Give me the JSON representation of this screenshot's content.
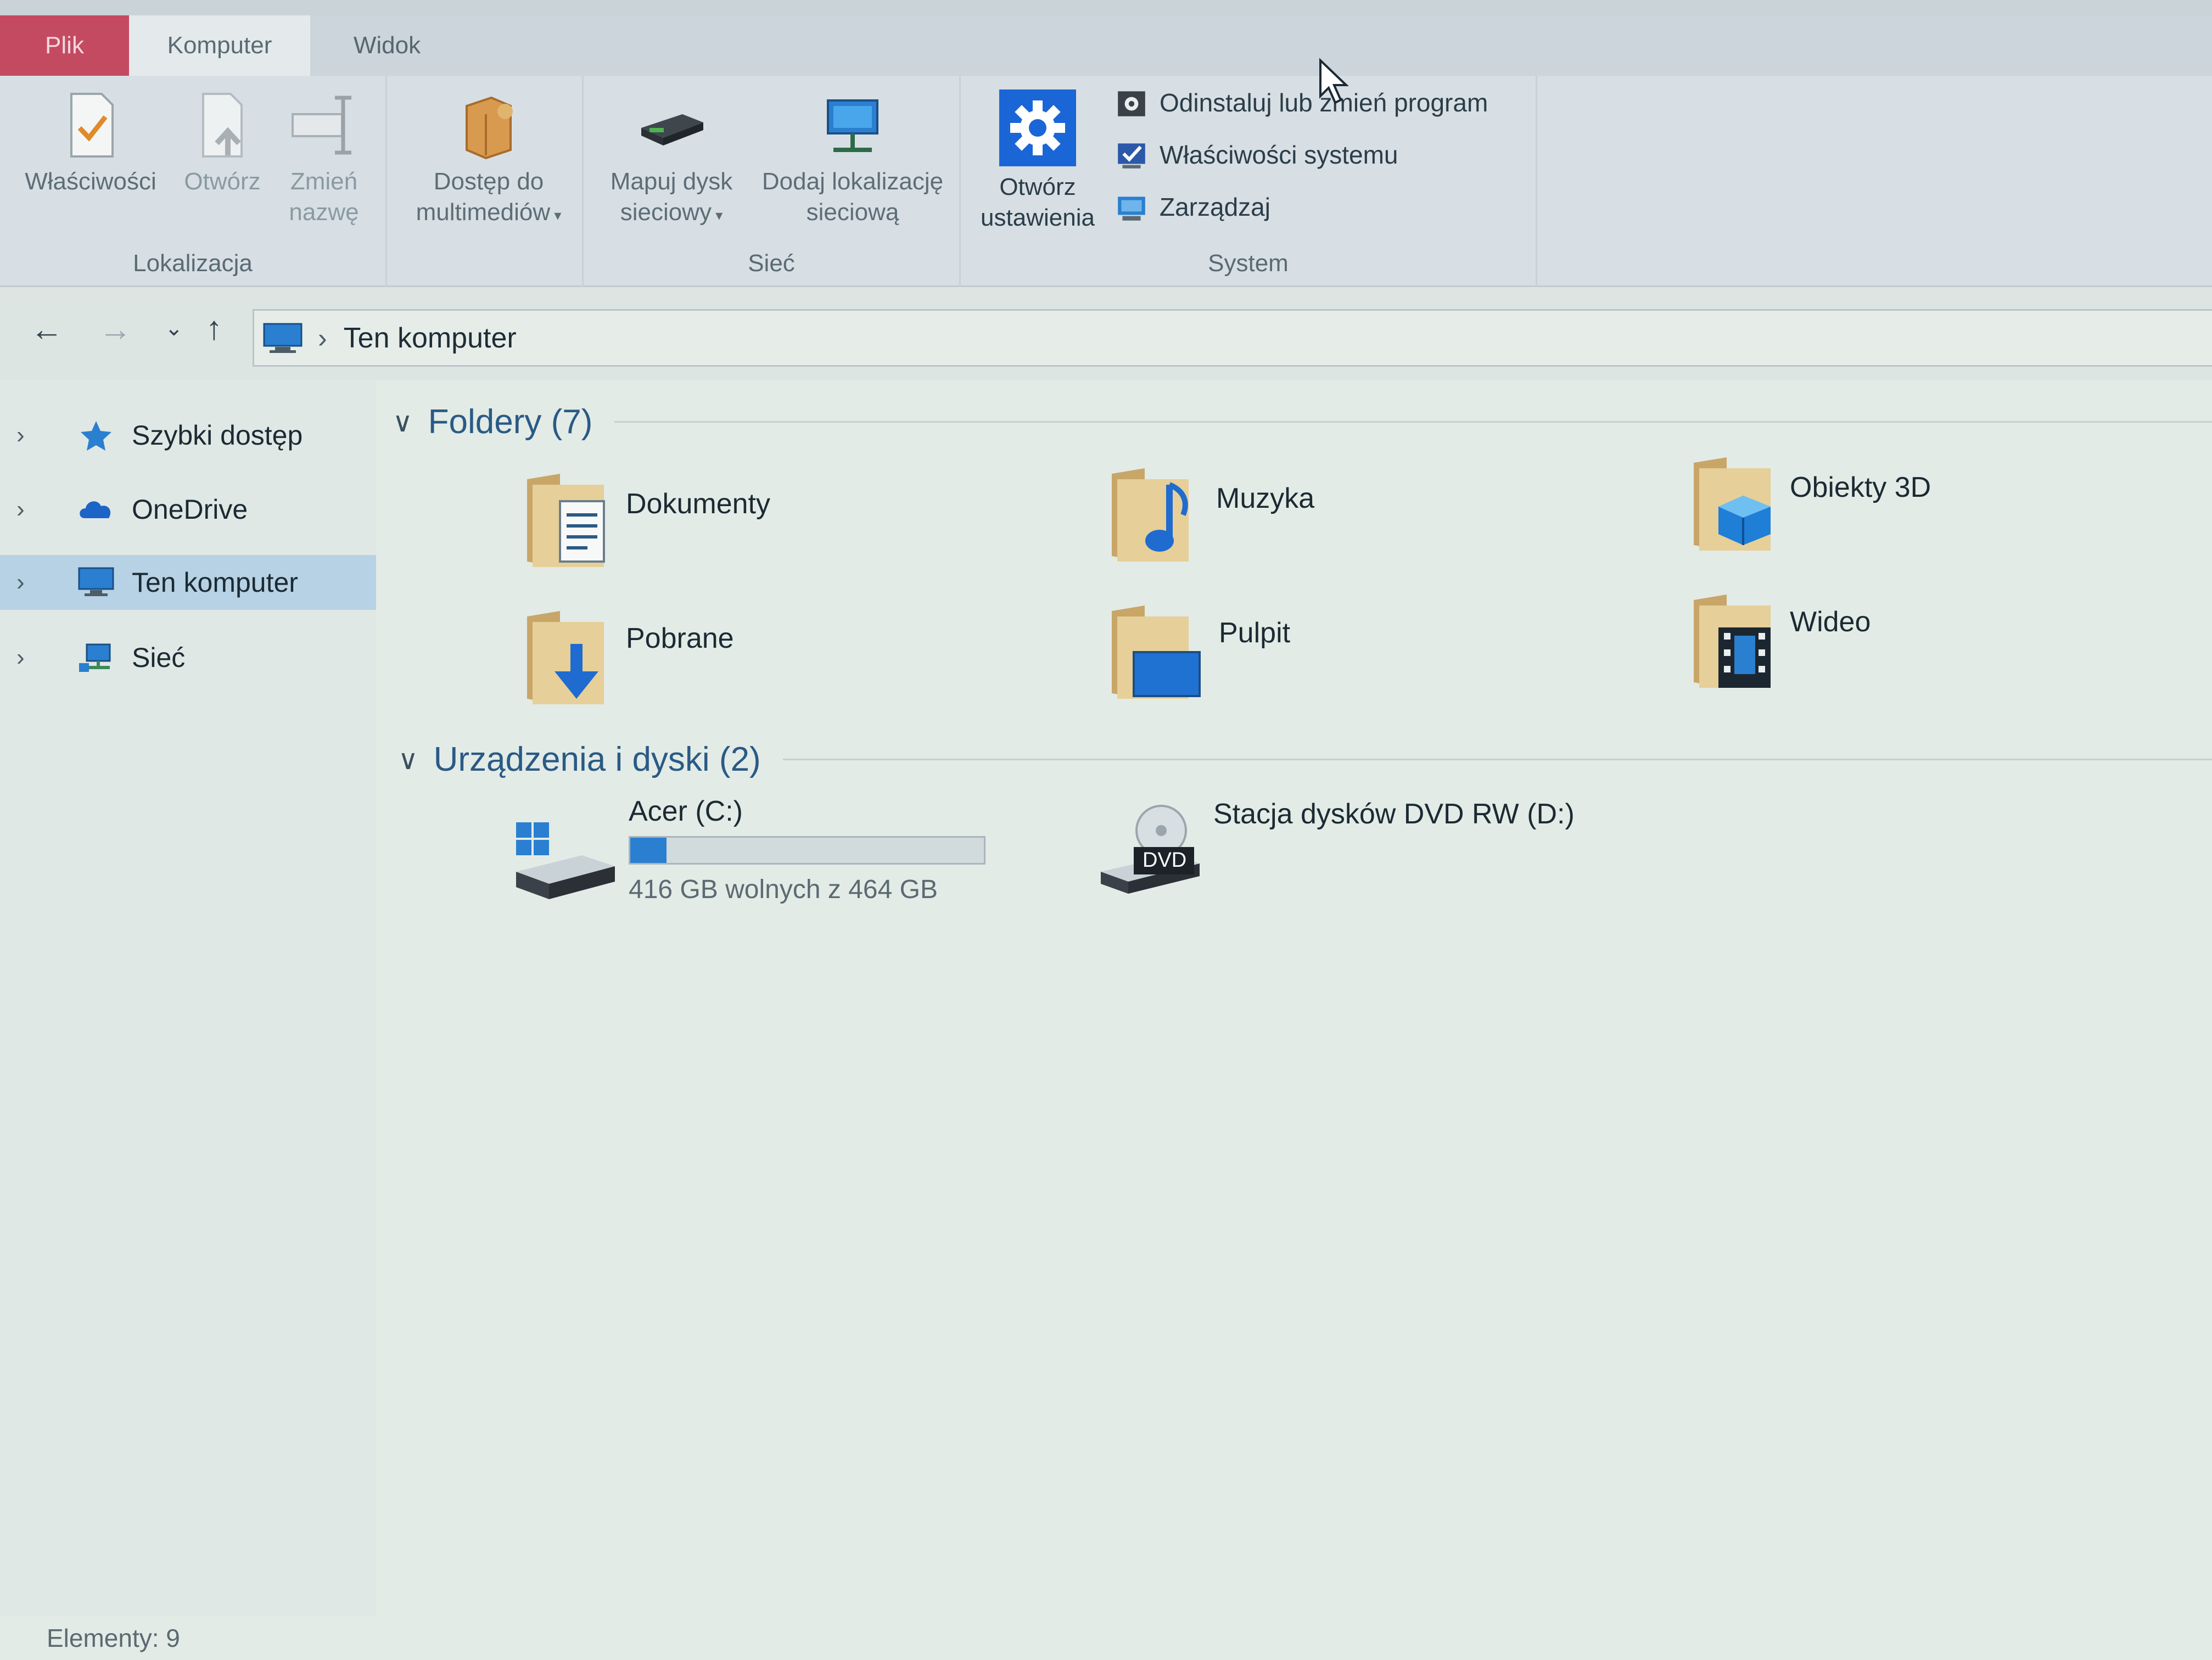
{
  "ribbon_tabs": [
    {
      "label": "Plik"
    },
    {
      "label": "Komputer"
    },
    {
      "label": "Widok"
    }
  ],
  "ribbon": {
    "location_group": {
      "label": "Lokalizacja",
      "properties": "Właściwości",
      "open": "Otwórz",
      "rename_line1": "Zmień",
      "rename_line2": "nazwę",
      "media_line1": "Dostęp do",
      "media_line2": "multimediów"
    },
    "network_group": {
      "label": "Sieć",
      "map_line1": "Mapuj dysk",
      "map_line2": "sieciowy",
      "add_line1": "Dodaj lokalizację",
      "add_line2": "sieciową"
    },
    "settings_line1": "Otwórz",
    "settings_line2": "ustawienia",
    "system_group": {
      "label": "System",
      "uninstall": "Odinstaluj lub zmień program",
      "system_properties": "Właściwości systemu",
      "manage": "Zarządzaj"
    }
  },
  "address": {
    "current": "Ten komputer"
  },
  "nav_pane": {
    "items": [
      {
        "label": "Szybki dostęp",
        "icon": "star-icon"
      },
      {
        "label": "OneDrive",
        "icon": "cloud-icon"
      },
      {
        "label": "Ten komputer",
        "icon": "computer-icon",
        "selected": true
      },
      {
        "label": "Sieć",
        "icon": "network-icon"
      }
    ]
  },
  "folders_group": {
    "header": "Foldery (7)",
    "items": [
      {
        "name": "Dokumenty",
        "icon": "documents-folder-icon"
      },
      {
        "name": "Muzyka",
        "icon": "music-folder-icon"
      },
      {
        "name": "Obiekty 3D",
        "icon": "3d-objects-folder-icon"
      },
      {
        "name": "Pobrane",
        "icon": "downloads-folder-icon"
      },
      {
        "name": "Pulpit",
        "icon": "desktop-folder-icon"
      },
      {
        "name": "Wideo",
        "icon": "videos-folder-icon"
      }
    ]
  },
  "devices_group": {
    "header": "Urządzenia i dyski (2)",
    "drives": [
      {
        "name": "Acer (C:)",
        "free_text": "416 GB wolnych z 464 GB",
        "used_fraction": 0.103,
        "icon": "windows-drive-icon"
      },
      {
        "name": "Stacja dysków DVD RW (D:)",
        "icon": "dvd-drive-icon",
        "badge": "DVD"
      }
    ]
  },
  "status": {
    "items_count": "Elementy: 9"
  },
  "colors": {
    "accent_blue": "#2a7fd0",
    "file_tab": "#c44a62",
    "selected_nav": "#b7d2e4"
  }
}
